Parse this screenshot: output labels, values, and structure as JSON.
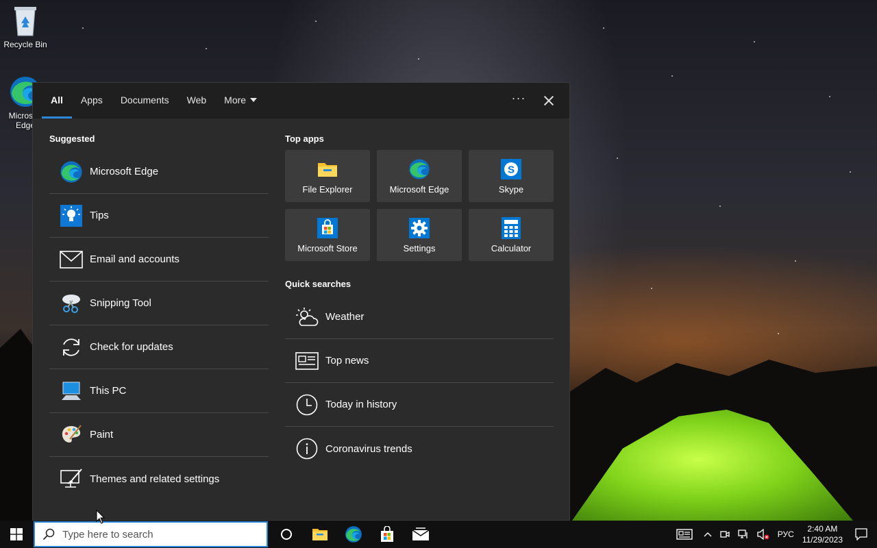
{
  "desktop": {
    "icons": [
      {
        "label": "Recycle Bin"
      },
      {
        "label": "Microsoft Edge"
      }
    ]
  },
  "flyout": {
    "tabs": [
      {
        "label": "All",
        "active": true
      },
      {
        "label": "Apps"
      },
      {
        "label": "Documents"
      },
      {
        "label": "Web"
      },
      {
        "label": "More"
      }
    ],
    "more_options_label": "···",
    "suggested_heading": "Suggested",
    "suggested": [
      {
        "label": "Microsoft Edge",
        "icon": "edge-icon"
      },
      {
        "label": "Tips",
        "icon": "lightbulb-icon"
      },
      {
        "label": "Email and accounts",
        "icon": "envelope-icon"
      },
      {
        "label": "Snipping Tool",
        "icon": "scissors-icon"
      },
      {
        "label": "Check for updates",
        "icon": "refresh-icon"
      },
      {
        "label": "This PC",
        "icon": "computer-icon"
      },
      {
        "label": "Paint",
        "icon": "palette-icon"
      },
      {
        "label": "Themes and related settings",
        "icon": "brush-icon"
      }
    ],
    "top_apps_heading": "Top apps",
    "top_apps": [
      {
        "label": "File Explorer",
        "icon": "folder-icon"
      },
      {
        "label": "Microsoft Edge",
        "icon": "edge-icon"
      },
      {
        "label": "Skype",
        "icon": "skype-icon"
      },
      {
        "label": "Microsoft Store",
        "icon": "store-icon"
      },
      {
        "label": "Settings",
        "icon": "gear-icon"
      },
      {
        "label": "Calculator",
        "icon": "calculator-icon"
      }
    ],
    "quick_searches_heading": "Quick searches",
    "quick_searches": [
      {
        "label": "Weather",
        "icon": "weather-icon"
      },
      {
        "label": "Top news",
        "icon": "news-icon"
      },
      {
        "label": "Today in history",
        "icon": "clock-icon"
      },
      {
        "label": "Coronavirus trends",
        "icon": "info-icon"
      }
    ]
  },
  "taskbar": {
    "search_placeholder": "Type here to search",
    "language": "РУС",
    "time": "2:40 AM",
    "date": "11/29/2023"
  },
  "colors": {
    "accent": "#2b88d8",
    "flyout_bg": "#2b2b2b",
    "tab_bar_bg": "#1f1f1f",
    "tile_bg": "#3c3c3c",
    "taskbar_bg": "#101010"
  }
}
